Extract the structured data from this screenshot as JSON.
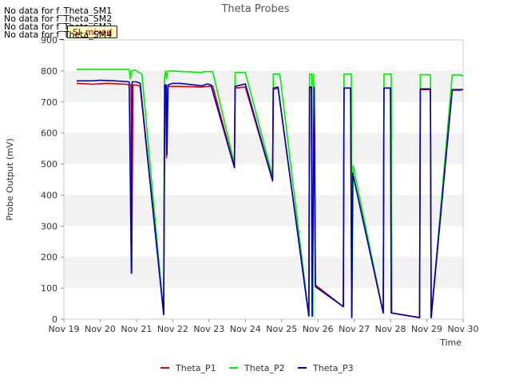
{
  "no_data_messages": [
    "No data for f_Theta_SM1",
    "No data for f_Theta_SM2",
    "No data for f_Theta_SM3",
    "No data for f_Theta_SM4"
  ],
  "flag_label": "SI_mixed",
  "chart_data": {
    "type": "line",
    "title": "Theta Probes",
    "xlabel": "Time",
    "ylabel": "Probe Output (mV)",
    "ylim": [
      0,
      900
    ],
    "xlim": [
      19,
      30
    ],
    "x_unit": "day of November",
    "yticks": [
      0,
      100,
      200,
      300,
      400,
      500,
      600,
      700,
      800,
      900
    ],
    "xticks": [
      19,
      20,
      21,
      22,
      23,
      24,
      25,
      26,
      27,
      28,
      29,
      30
    ],
    "xtick_labels": [
      "Nov 19",
      "Nov 20",
      "Nov 21",
      "Nov 22",
      "Nov 23",
      "Nov 24",
      "Nov 25",
      "Nov 26",
      "Nov 27",
      "Nov 28",
      "Nov 29",
      "Nov 30"
    ],
    "grid": "horizontal bands",
    "legend_position": "bottom",
    "series": [
      {
        "name": "Theta_P1",
        "color": "#dd0000",
        "points": [
          [
            19.35,
            760
          ],
          [
            19.8,
            757
          ],
          [
            20.2,
            760
          ],
          [
            20.7,
            757
          ],
          [
            20.85,
            755
          ],
          [
            20.87,
            150
          ],
          [
            20.9,
            755
          ],
          [
            21.0,
            755
          ],
          [
            21.1,
            750
          ],
          [
            21.75,
            15
          ],
          [
            21.78,
            745
          ],
          [
            21.8,
            750
          ],
          [
            21.83,
            520
          ],
          [
            21.86,
            750
          ],
          [
            22.0,
            750
          ],
          [
            22.2,
            750
          ],
          [
            22.8,
            748
          ],
          [
            23.1,
            752
          ],
          [
            23.7,
            490
          ],
          [
            23.72,
            745
          ],
          [
            24.0,
            748
          ],
          [
            24.75,
            445
          ],
          [
            24.77,
            740
          ],
          [
            24.9,
            745
          ],
          [
            25.75,
            10
          ],
          [
            25.77,
            745
          ],
          [
            25.82,
            745
          ],
          [
            25.84,
            10
          ],
          [
            25.9,
            745
          ],
          [
            25.93,
            110
          ],
          [
            26.7,
            40
          ],
          [
            26.72,
            745
          ],
          [
            26.9,
            745
          ],
          [
            26.93,
            10
          ],
          [
            26.96,
            470
          ],
          [
            27.8,
            20
          ],
          [
            27.82,
            745
          ],
          [
            28.0,
            745
          ],
          [
            28.02,
            20
          ],
          [
            28.8,
            5
          ],
          [
            28.82,
            740
          ],
          [
            29.1,
            740
          ],
          [
            29.12,
            5
          ],
          [
            29.7,
            740
          ],
          [
            30.0,
            740
          ]
        ]
      },
      {
        "name": "Theta_P2",
        "color": "#00ee00",
        "points": [
          [
            19.35,
            805
          ],
          [
            20.8,
            805
          ],
          [
            20.83,
            775
          ],
          [
            20.86,
            800
          ],
          [
            20.98,
            803
          ],
          [
            21.0,
            800
          ],
          [
            21.15,
            790
          ],
          [
            21.75,
            15
          ],
          [
            21.77,
            775
          ],
          [
            21.8,
            800
          ],
          [
            21.83,
            775
          ],
          [
            21.86,
            800
          ],
          [
            22.0,
            800
          ],
          [
            22.8,
            795
          ],
          [
            22.85,
            798
          ],
          [
            23.1,
            798
          ],
          [
            23.7,
            500
          ],
          [
            23.72,
            795
          ],
          [
            24.0,
            795
          ],
          [
            24.75,
            460
          ],
          [
            24.77,
            790
          ],
          [
            24.95,
            790
          ],
          [
            25.75,
            10
          ],
          [
            25.77,
            790
          ],
          [
            25.83,
            790
          ],
          [
            25.86,
            10
          ],
          [
            25.88,
            790
          ],
          [
            25.93,
            110
          ],
          [
            26.7,
            40
          ],
          [
            26.72,
            790
          ],
          [
            26.92,
            790
          ],
          [
            26.94,
            10
          ],
          [
            26.97,
            495
          ],
          [
            27.8,
            20
          ],
          [
            27.82,
            790
          ],
          [
            28.02,
            790
          ],
          [
            28.04,
            20
          ],
          [
            28.8,
            5
          ],
          [
            28.82,
            788
          ],
          [
            29.1,
            788
          ],
          [
            29.12,
            5
          ],
          [
            29.7,
            787
          ],
          [
            29.95,
            787
          ],
          [
            30.0,
            782
          ]
        ]
      },
      {
        "name": "Theta_P3",
        "color": "#0000bb",
        "points": [
          [
            19.35,
            768
          ],
          [
            19.8,
            768
          ],
          [
            20.0,
            770
          ],
          [
            20.4,
            768
          ],
          [
            20.8,
            765
          ],
          [
            20.86,
            148
          ],
          [
            20.88,
            765
          ],
          [
            21.0,
            765
          ],
          [
            21.1,
            760
          ],
          [
            21.75,
            15
          ],
          [
            21.78,
            755
          ],
          [
            21.82,
            755
          ],
          [
            21.84,
            530
          ],
          [
            21.87,
            755
          ],
          [
            22.0,
            760
          ],
          [
            22.2,
            760
          ],
          [
            22.8,
            752
          ],
          [
            22.95,
            758
          ],
          [
            23.05,
            755
          ],
          [
            23.7,
            488
          ],
          [
            23.72,
            750
          ],
          [
            24.0,
            758
          ],
          [
            24.75,
            448
          ],
          [
            24.77,
            745
          ],
          [
            24.9,
            748
          ],
          [
            25.75,
            10
          ],
          [
            25.77,
            748
          ],
          [
            25.82,
            748
          ],
          [
            25.84,
            10
          ],
          [
            25.9,
            748
          ],
          [
            25.93,
            105
          ],
          [
            26.7,
            40
          ],
          [
            26.72,
            745
          ],
          [
            26.9,
            745
          ],
          [
            26.93,
            5
          ],
          [
            26.96,
            470
          ],
          [
            27.8,
            20
          ],
          [
            27.82,
            745
          ],
          [
            28.0,
            745
          ],
          [
            28.02,
            20
          ],
          [
            28.8,
            5
          ],
          [
            28.82,
            742
          ],
          [
            29.1,
            742
          ],
          [
            29.12,
            5
          ],
          [
            29.7,
            738
          ],
          [
            29.9,
            738
          ],
          [
            30.0,
            740
          ]
        ]
      }
    ]
  }
}
